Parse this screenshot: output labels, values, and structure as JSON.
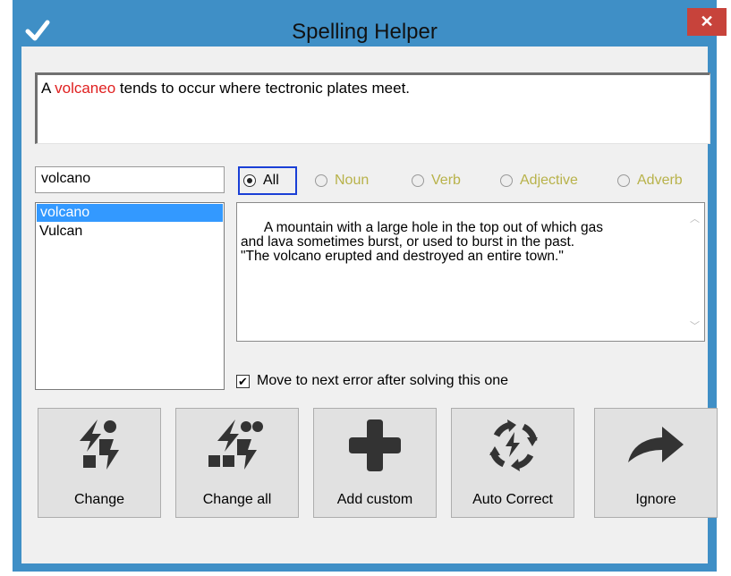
{
  "window": {
    "title": "Spelling Helper",
    "close_glyph": "✕",
    "app_icon": "checkmark-icon"
  },
  "sentence": {
    "before": "A ",
    "error_word": "volcaneo",
    "after": " tends to occur where tectronic plates meet."
  },
  "word_input": {
    "value": "volcano"
  },
  "suggestions": [
    {
      "label": "volcano",
      "selected": true
    },
    {
      "label": "Vulcan",
      "selected": false
    }
  ],
  "parts_of_speech": [
    {
      "label": "All",
      "checked": true,
      "enabled": true
    },
    {
      "label": "Noun",
      "checked": false,
      "enabled": false
    },
    {
      "label": "Verb",
      "checked": false,
      "enabled": false
    },
    {
      "label": "Adjective",
      "checked": false,
      "enabled": false
    },
    {
      "label": "Adverb",
      "checked": false,
      "enabled": false
    }
  ],
  "definition": "A mountain with a large hole in the top out of which gas\nand lava sometimes burst, or used to burst in the past.\n\"The volcano erupted and destroyed an entire town.\"",
  "move_next": {
    "label": "Move to next error after solving this one",
    "checked": true
  },
  "actions": [
    {
      "label": "Change",
      "icon": "change-icon"
    },
    {
      "label": "Change all",
      "icon": "change-all-icon"
    },
    {
      "label": "Add custom",
      "icon": "plus-icon"
    },
    {
      "label": "Auto Correct",
      "icon": "auto-correct-icon"
    },
    {
      "label": "Ignore",
      "icon": "forward-arrow-icon"
    }
  ],
  "colors": {
    "titlebar": "#3f8fc6",
    "close": "#c7433b",
    "error_text": "#e02020",
    "selection": "#3399ff",
    "focus_border": "#1a3fd6",
    "disabled_text": "#b8b24a"
  }
}
